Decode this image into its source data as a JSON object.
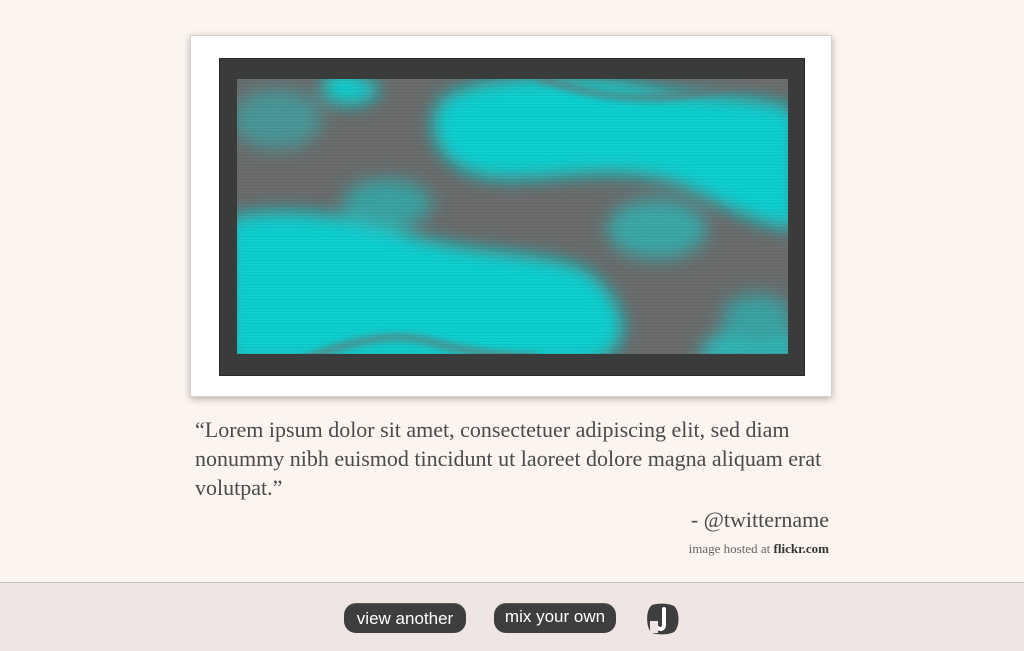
{
  "quote": {
    "text": "“Lorem ipsum dolor sit amet, consectetuer adipiscing elit, sed diam nonummy nibh euismod tincidunt ut laoreet dolore magna aliquam erat volutpat.”",
    "author": "- @twittername",
    "hosted_prefix": "image hosted at ",
    "hosted_site": "flickr.com"
  },
  "toolbar": {
    "view_another_label": "view another",
    "mix_your_own_label": "mix your own",
    "logo_icon": "brand-logo-icon"
  },
  "colors": {
    "background": "#fdf4f0",
    "art_cyan": "#10d0d0",
    "art_gray": "#6a6a6a",
    "button": "#3e3e3e"
  }
}
